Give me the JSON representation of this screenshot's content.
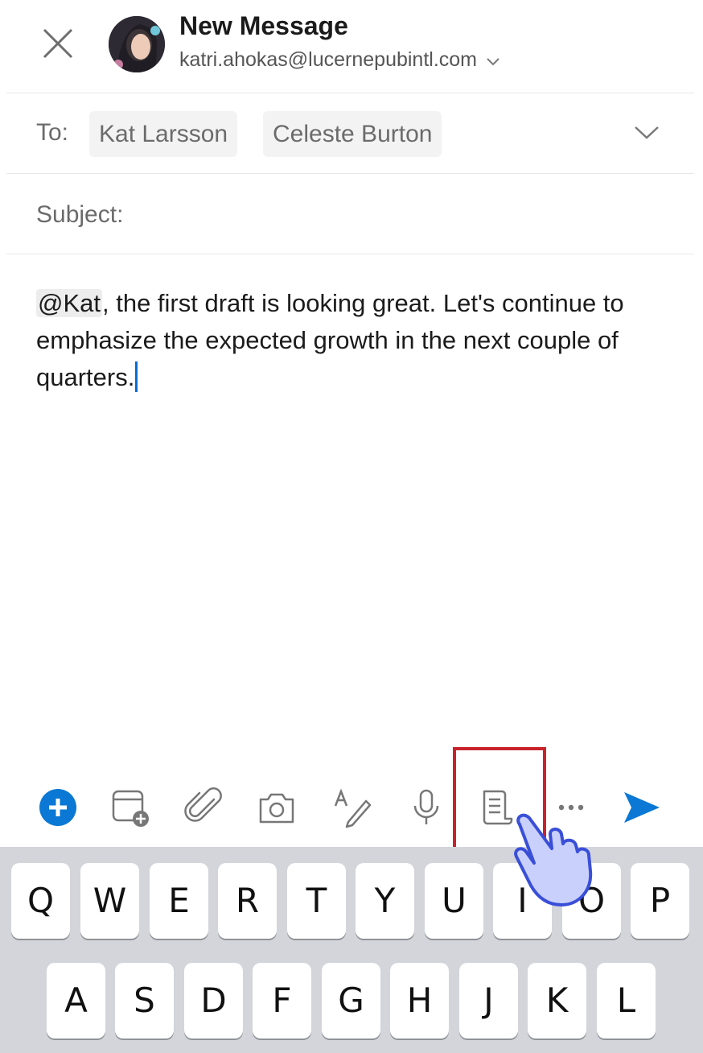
{
  "header": {
    "title": "New Message",
    "account": "katri.ahokas@lucernepubintl.com"
  },
  "to": {
    "label": "To:",
    "recipients": [
      "Kat Larsson",
      "Celeste Burton"
    ]
  },
  "subject": {
    "label": "Subject:",
    "value": ""
  },
  "message": {
    "mention": "@Kat",
    "text": ", the first draft is looking great. Let's continue to emphasize the expected growth in the next couple of quarters."
  },
  "toolbar": {
    "icons": [
      "add-icon",
      "calendar-add-icon",
      "attach-icon",
      "camera-icon",
      "draw-icon",
      "microphone-icon",
      "template-icon",
      "more-icon",
      "send-icon"
    ]
  },
  "colors": {
    "accent": "#0a78d4",
    "highlight": "#c8232b",
    "keyboard_bg": "#d3d5db"
  },
  "keyboard": {
    "row1": [
      "Q",
      "W",
      "E",
      "R",
      "T",
      "Y",
      "U",
      "I",
      "O",
      "P"
    ],
    "row2": [
      "A",
      "S",
      "D",
      "F",
      "G",
      "H",
      "J",
      "K",
      "L"
    ]
  }
}
